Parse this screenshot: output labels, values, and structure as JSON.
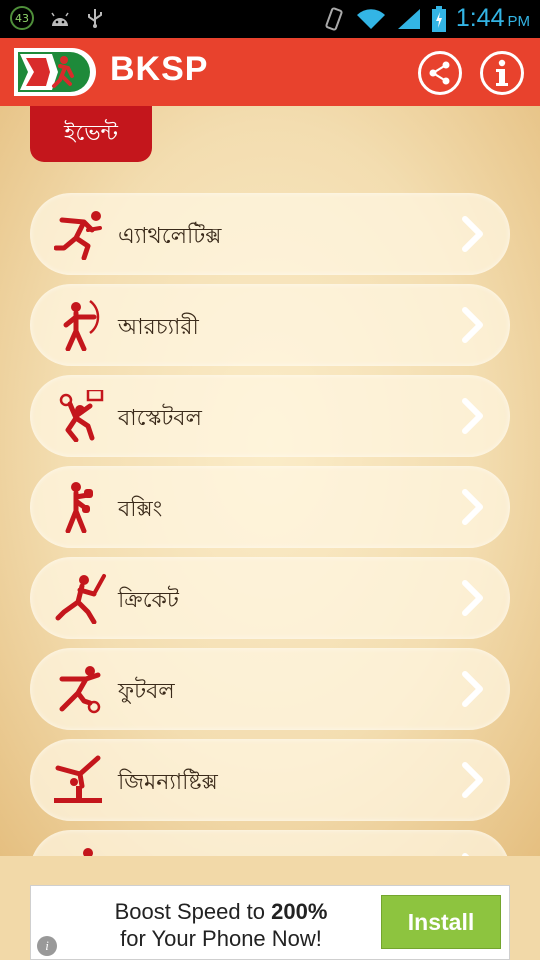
{
  "status_bar": {
    "badge": "43",
    "time": "1:44",
    "ampm": "PM"
  },
  "app_bar": {
    "title": "BKSP",
    "share_icon": "share-icon",
    "info_icon": "info-icon"
  },
  "section": {
    "label": "ইভেন্ট"
  },
  "events": [
    {
      "label": "এ্যাথলেটিক্স",
      "icon": "athletics-icon"
    },
    {
      "label": "আরচ্যারী",
      "icon": "archery-icon"
    },
    {
      "label": "বাস্কেটবল",
      "icon": "basketball-icon"
    },
    {
      "label": "বক্সিং",
      "icon": "boxing-icon"
    },
    {
      "label": "ক্রিকেট",
      "icon": "cricket-icon"
    },
    {
      "label": "ফুটবল",
      "icon": "football-icon"
    },
    {
      "label": "জিমন্যাষ্টিক্স",
      "icon": "gymnastics-icon"
    },
    {
      "label": "",
      "icon": "sport-icon"
    }
  ],
  "ad": {
    "line1_prefix": "Boost Speed to ",
    "line1_bold": "200%",
    "line2": "for Your Phone Now!",
    "button": "Install"
  },
  "colors": {
    "app_bar": "#e8422d",
    "tab": "#c4161c",
    "icon": "#c4161c",
    "install": "#8dc43f"
  }
}
